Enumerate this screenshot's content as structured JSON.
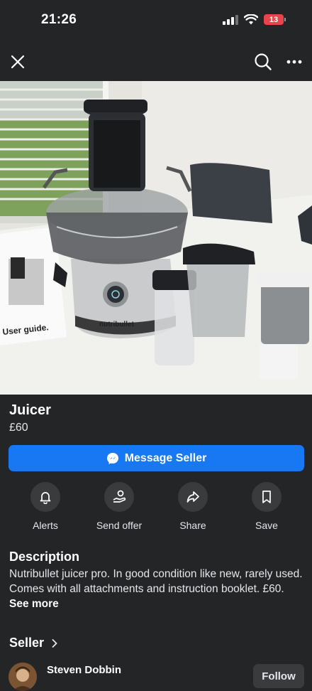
{
  "status_bar": {
    "time": "21:26",
    "battery_level": "13"
  },
  "listing": {
    "image_caption": "User guide.",
    "image_brand_text": "nutribullet",
    "title": "Juicer",
    "price": "£60"
  },
  "message_button": {
    "label": "Message Seller"
  },
  "actions": [
    {
      "label": "Alerts",
      "icon": "bell-icon"
    },
    {
      "label": "Send offer",
      "icon": "offer-icon"
    },
    {
      "label": "Share",
      "icon": "share-icon"
    },
    {
      "label": "Save",
      "icon": "bookmark-icon"
    }
  ],
  "description": {
    "heading": "Description",
    "text": "Nutribullet juicer pro. In good condition like new, rarely used. Comes with all attachments and instruction booklet. £60.",
    "see_more": "See more"
  },
  "seller": {
    "heading": "Seller",
    "name": "Steven Dobbin",
    "follow_label": "Follow"
  },
  "colors": {
    "accent": "#1877f2",
    "background": "#242526",
    "battery": "#e8454a"
  }
}
